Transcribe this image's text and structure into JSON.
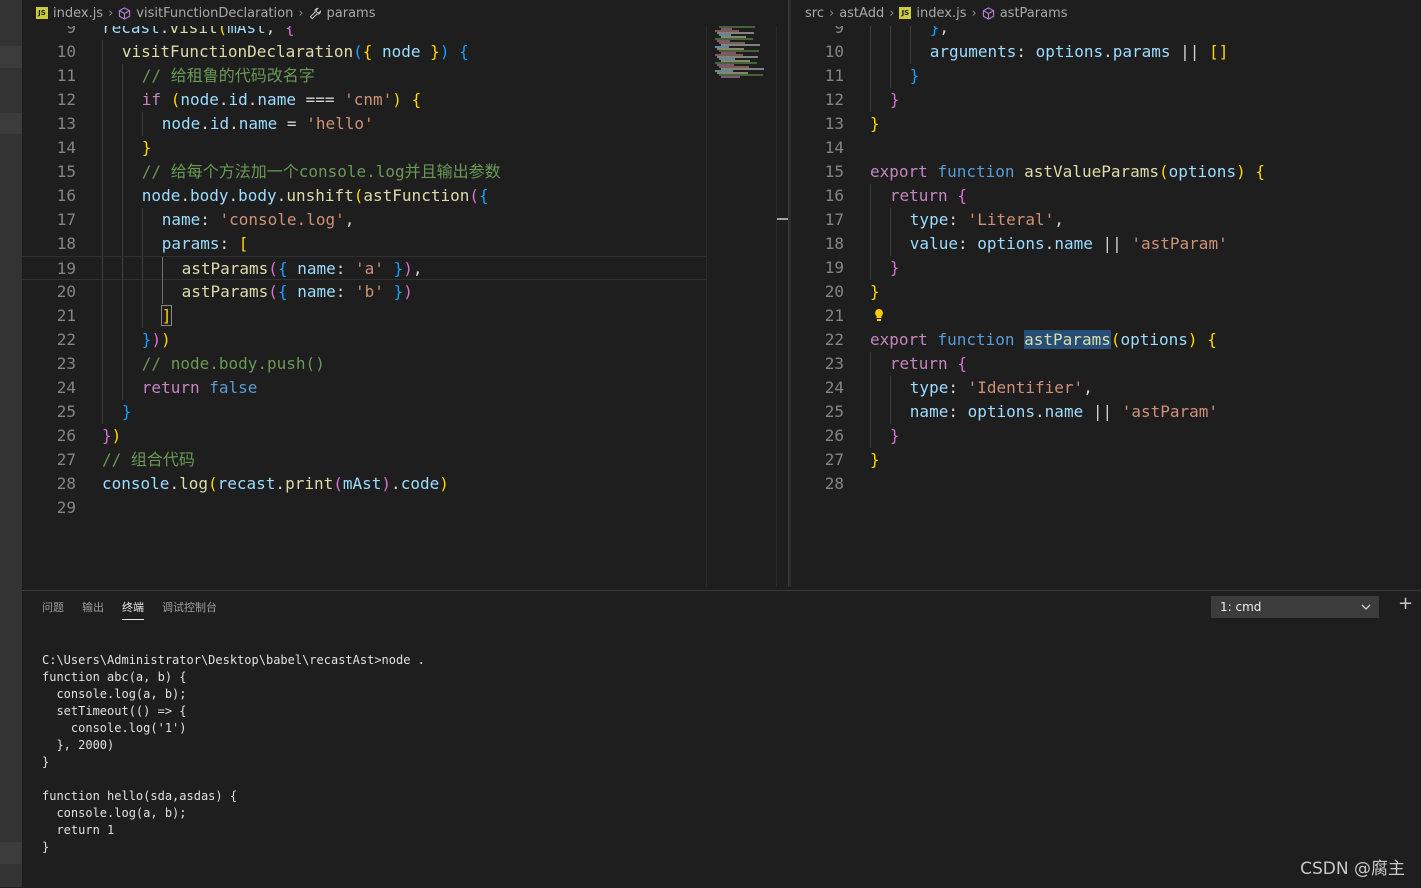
{
  "left_editor": {
    "breadcrumb": [
      {
        "label": "index.js",
        "icon": "js-file-icon"
      },
      {
        "label": "visitFunctionDeclaration",
        "icon": "cube-icon"
      },
      {
        "label": "params",
        "icon": "wrench-icon"
      }
    ],
    "lines": [
      {
        "n": "9",
        "indent": 0,
        "tokens": [
          [
            "v",
            "recast"
          ],
          [
            "p",
            "."
          ],
          [
            "f",
            "visit"
          ],
          [
            "b1",
            "("
          ],
          [
            "v",
            "mAst"
          ],
          [
            "p",
            ", "
          ],
          [
            "b2",
            "{"
          ]
        ]
      },
      {
        "n": "10",
        "indent": 1,
        "tokens": [
          [
            "f",
            "visitFunctionDeclaration"
          ],
          [
            "b3",
            "("
          ],
          [
            "b1",
            "{"
          ],
          [
            "p",
            " "
          ],
          [
            "v",
            "node"
          ],
          [
            "p",
            " "
          ],
          [
            "b1",
            "}"
          ],
          [
            "b3",
            ")"
          ],
          [
            "p",
            " "
          ],
          [
            "b3",
            "{"
          ]
        ]
      },
      {
        "n": "11",
        "indent": 2,
        "tokens": [
          [
            "c",
            "// 给租鲁的代码改名字"
          ]
        ]
      },
      {
        "n": "12",
        "indent": 2,
        "tokens": [
          [
            "k",
            "if"
          ],
          [
            "p",
            " "
          ],
          [
            "b1",
            "("
          ],
          [
            "v",
            "node"
          ],
          [
            "p",
            "."
          ],
          [
            "v",
            "id"
          ],
          [
            "p",
            "."
          ],
          [
            "v",
            "name"
          ],
          [
            "p",
            " === "
          ],
          [
            "s",
            "'cnm'"
          ],
          [
            "b1",
            ")"
          ],
          [
            "p",
            " "
          ],
          [
            "b1",
            "{"
          ]
        ]
      },
      {
        "n": "13",
        "indent": 3,
        "tokens": [
          [
            "v",
            "node"
          ],
          [
            "p",
            "."
          ],
          [
            "v",
            "id"
          ],
          [
            "p",
            "."
          ],
          [
            "v",
            "name"
          ],
          [
            "p",
            " = "
          ],
          [
            "s",
            "'hello'"
          ]
        ]
      },
      {
        "n": "14",
        "indent": 2,
        "tokens": [
          [
            "b1",
            "}"
          ]
        ]
      },
      {
        "n": "15",
        "indent": 2,
        "tokens": [
          [
            "c",
            "// 给每个方法加一个console.log并且输出参数"
          ]
        ]
      },
      {
        "n": "16",
        "indent": 2,
        "tokens": [
          [
            "v",
            "node"
          ],
          [
            "p",
            "."
          ],
          [
            "v",
            "body"
          ],
          [
            "p",
            "."
          ],
          [
            "v",
            "body"
          ],
          [
            "p",
            "."
          ],
          [
            "f",
            "unshift"
          ],
          [
            "b1",
            "("
          ],
          [
            "f",
            "astFunction"
          ],
          [
            "b2",
            "("
          ],
          [
            "b3",
            "{"
          ]
        ]
      },
      {
        "n": "17",
        "indent": 3,
        "tokens": [
          [
            "v",
            "name"
          ],
          [
            "p",
            ": "
          ],
          [
            "s",
            "'console.log'"
          ],
          [
            "p",
            ","
          ]
        ]
      },
      {
        "n": "18",
        "indent": 3,
        "tokens": [
          [
            "v",
            "params"
          ],
          [
            "p",
            ": "
          ],
          [
            "b1",
            "["
          ]
        ]
      },
      {
        "n": "19",
        "indent": 4,
        "tokens": [
          [
            "f",
            "astParams"
          ],
          [
            "b2",
            "("
          ],
          [
            "b3",
            "{"
          ],
          [
            "p",
            " "
          ],
          [
            "v",
            "name"
          ],
          [
            "p",
            ": "
          ],
          [
            "s",
            "'a'"
          ],
          [
            "p",
            " "
          ],
          [
            "b3",
            "}"
          ],
          [
            "b2",
            ")"
          ],
          [
            "p",
            ","
          ]
        ]
      },
      {
        "n": "20",
        "indent": 4,
        "tokens": [
          [
            "f",
            "astParams"
          ],
          [
            "b2",
            "("
          ],
          [
            "b3",
            "{"
          ],
          [
            "p",
            " "
          ],
          [
            "v",
            "name"
          ],
          [
            "p",
            ": "
          ],
          [
            "s",
            "'b'"
          ],
          [
            "p",
            " "
          ],
          [
            "b3",
            "}"
          ],
          [
            "b2",
            ")"
          ]
        ]
      },
      {
        "n": "21",
        "indent": 3,
        "tokens": [
          [
            "b1",
            "]"
          ]
        ]
      },
      {
        "n": "22",
        "indent": 2,
        "tokens": [
          [
            "b3",
            "}"
          ],
          [
            "b2",
            ")"
          ],
          [
            "b1",
            ")"
          ]
        ]
      },
      {
        "n": "23",
        "indent": 2,
        "tokens": [
          [
            "c",
            "// node.body.push()"
          ]
        ]
      },
      {
        "n": "24",
        "indent": 2,
        "tokens": [
          [
            "k",
            "return"
          ],
          [
            "p",
            " "
          ],
          [
            "kb",
            "false"
          ]
        ]
      },
      {
        "n": "25",
        "indent": 1,
        "tokens": [
          [
            "b3",
            "}"
          ]
        ]
      },
      {
        "n": "26",
        "indent": 0,
        "tokens": [
          [
            "b2",
            "}"
          ],
          [
            "b1",
            ")"
          ]
        ]
      },
      {
        "n": "27",
        "indent": 0,
        "tokens": [
          [
            "c",
            "// 组合代码"
          ]
        ]
      },
      {
        "n": "28",
        "indent": 0,
        "tokens": [
          [
            "v",
            "console"
          ],
          [
            "p",
            "."
          ],
          [
            "f",
            "log"
          ],
          [
            "b1",
            "("
          ],
          [
            "v",
            "recast"
          ],
          [
            "p",
            "."
          ],
          [
            "f",
            "print"
          ],
          [
            "b2",
            "("
          ],
          [
            "v",
            "mAst"
          ],
          [
            "b2",
            ")"
          ],
          [
            "p",
            "."
          ],
          [
            "v",
            "code"
          ],
          [
            "b1",
            ")"
          ]
        ]
      },
      {
        "n": "29",
        "indent": 0,
        "tokens": []
      }
    ]
  },
  "right_editor": {
    "breadcrumb": [
      {
        "label": "src",
        "icon": ""
      },
      {
        "label": "astAdd",
        "icon": ""
      },
      {
        "label": "index.js",
        "icon": "js-file-icon"
      },
      {
        "label": "astParams",
        "icon": "cube-icon"
      }
    ],
    "lines": [
      {
        "n": "9",
        "indent": 3,
        "tokens": [
          [
            "b3",
            "}"
          ],
          [
            "p",
            ","
          ]
        ]
      },
      {
        "n": "10",
        "indent": 3,
        "tokens": [
          [
            "v",
            "arguments"
          ],
          [
            "p",
            ": "
          ],
          [
            "v",
            "options"
          ],
          [
            "p",
            "."
          ],
          [
            "v",
            "params"
          ],
          [
            "p",
            " || "
          ],
          [
            "b1",
            "[]"
          ]
        ]
      },
      {
        "n": "11",
        "indent": 2,
        "tokens": [
          [
            "b3",
            "}"
          ]
        ]
      },
      {
        "n": "12",
        "indent": 1,
        "tokens": [
          [
            "b2",
            "}"
          ]
        ]
      },
      {
        "n": "13",
        "indent": 0,
        "tokens": [
          [
            "b1",
            "}"
          ]
        ]
      },
      {
        "n": "14",
        "indent": 0,
        "tokens": []
      },
      {
        "n": "15",
        "indent": 0,
        "tokens": [
          [
            "k",
            "export"
          ],
          [
            "p",
            " "
          ],
          [
            "kb",
            "function"
          ],
          [
            "p",
            " "
          ],
          [
            "f",
            "astValueParams"
          ],
          [
            "b1",
            "("
          ],
          [
            "v",
            "options"
          ],
          [
            "b1",
            ")"
          ],
          [
            "p",
            " "
          ],
          [
            "b1",
            "{"
          ]
        ]
      },
      {
        "n": "16",
        "indent": 1,
        "tokens": [
          [
            "k",
            "return"
          ],
          [
            "p",
            " "
          ],
          [
            "b2",
            "{"
          ]
        ]
      },
      {
        "n": "17",
        "indent": 2,
        "tokens": [
          [
            "v",
            "type"
          ],
          [
            "p",
            ": "
          ],
          [
            "s",
            "'Literal'"
          ],
          [
            "p",
            ","
          ]
        ]
      },
      {
        "n": "18",
        "indent": 2,
        "tokens": [
          [
            "v",
            "value"
          ],
          [
            "p",
            ": "
          ],
          [
            "v",
            "options"
          ],
          [
            "p",
            "."
          ],
          [
            "v",
            "name"
          ],
          [
            "p",
            " || "
          ],
          [
            "s",
            "'astParam'"
          ]
        ]
      },
      {
        "n": "19",
        "indent": 1,
        "tokens": [
          [
            "b2",
            "}"
          ]
        ]
      },
      {
        "n": "20",
        "indent": 0,
        "tokens": [
          [
            "b1",
            "}"
          ]
        ]
      },
      {
        "n": "21",
        "indent": 0,
        "tokens": []
      },
      {
        "n": "22",
        "indent": 0,
        "tokens": [
          [
            "k",
            "export"
          ],
          [
            "p",
            " "
          ],
          [
            "kb",
            "function"
          ],
          [
            "p",
            " "
          ],
          [
            "f hl",
            "astParams"
          ],
          [
            "b1",
            "("
          ],
          [
            "v",
            "options"
          ],
          [
            "b1",
            ")"
          ],
          [
            "p",
            " "
          ],
          [
            "b1",
            "{"
          ]
        ]
      },
      {
        "n": "23",
        "indent": 1,
        "tokens": [
          [
            "k",
            "return"
          ],
          [
            "p",
            " "
          ],
          [
            "b2",
            "{"
          ]
        ]
      },
      {
        "n": "24",
        "indent": 2,
        "tokens": [
          [
            "v",
            "type"
          ],
          [
            "p",
            ": "
          ],
          [
            "s",
            "'Identifier'"
          ],
          [
            "p",
            ","
          ]
        ]
      },
      {
        "n": "25",
        "indent": 2,
        "tokens": [
          [
            "v",
            "name"
          ],
          [
            "p",
            ": "
          ],
          [
            "v",
            "options"
          ],
          [
            "p",
            "."
          ],
          [
            "v",
            "name"
          ],
          [
            "p",
            " || "
          ],
          [
            "s",
            "'astParam'"
          ]
        ]
      },
      {
        "n": "26",
        "indent": 1,
        "tokens": [
          [
            "b2",
            "}"
          ]
        ]
      },
      {
        "n": "27",
        "indent": 0,
        "tokens": [
          [
            "b1",
            "}"
          ]
        ]
      },
      {
        "n": "28",
        "indent": 0,
        "tokens": []
      }
    ]
  },
  "panel": {
    "tabs": [
      "问题",
      "输出",
      "终端",
      "调试控制台"
    ],
    "active_tab": "终端",
    "terminal_select": "1: cmd",
    "terminal_output": "C:\\Users\\Administrator\\Desktop\\babel\\recastAst>node .\nfunction abc(a, b) {\n  console.log(a, b);\n  setTimeout(() => {\n    console.log('1')\n  }, 2000)\n}\n\nfunction hello(sda,asdas) {\n  console.log(a, b);\n  return 1\n}"
  },
  "watermark": "CSDN @腐主",
  "colors": {
    "keyword": "#c586c0",
    "storage": "#569cd6",
    "function": "#dcdcaa",
    "variable": "#9cdcfe",
    "string": "#ce9178",
    "comment": "#6a9955",
    "bracket1": "#ffd700",
    "bracket2": "#da70d6",
    "bracket3": "#179fff"
  }
}
